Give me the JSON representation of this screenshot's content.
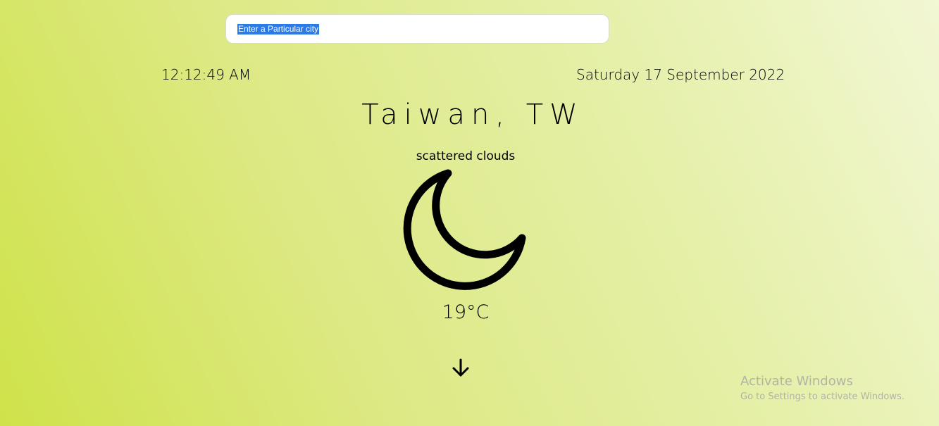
{
  "search": {
    "placeholder": "Enter a Particular city",
    "selected_text": "Enter a Particular city"
  },
  "clock": {
    "time": "12:12:49 AM",
    "date": "Saturday 17 September 2022"
  },
  "weather": {
    "location": "Taiwan, TW",
    "description": "scattered clouds",
    "icon": "moon-icon",
    "temperature": "19°C"
  },
  "scroll": {
    "icon": "arrow-down-icon"
  },
  "watermark": {
    "title": "Activate Windows",
    "subtitle": "Go to Settings to activate Windows."
  },
  "colors": {
    "gradient_start": "#cfe24a",
    "gradient_end": "#f2f7d4",
    "selection": "#2c7ae6",
    "icon": "#000000",
    "watermark": "#b1b4a2"
  }
}
